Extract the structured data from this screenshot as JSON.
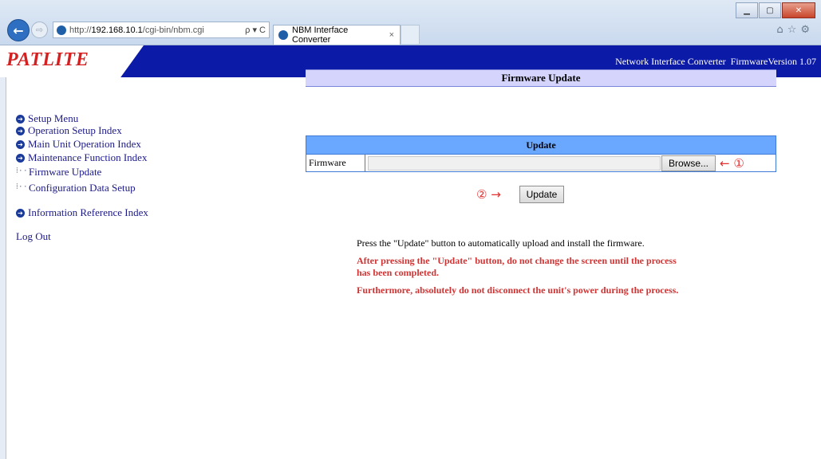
{
  "browser": {
    "url_prefix": "http://",
    "url_host": "192.168.10.1",
    "url_path": "/cgi-bin/nbm.cgi",
    "tab_title": "NBM Interface Converter",
    "tab_close": "×",
    "address_tools": "ρ ▾ C"
  },
  "header": {
    "logo": "PATLITE",
    "info": "Network Interface Converter  FirmwareVersion 1.07"
  },
  "sidebar": {
    "setup_menu": "Setup Menu",
    "operation_setup": "Operation Setup Index",
    "main_unit": "Main Unit Operation Index",
    "maintenance": "Maintenance Function Index",
    "firmware_update": "Firmware Update",
    "config_data": "Configuration Data Setup",
    "info_ref": "Information Reference Index",
    "logout": "Log Out"
  },
  "main": {
    "title": "Firmware Update",
    "table_header": "Update",
    "firmware_label": "Firmware",
    "browse_label": "Browse...",
    "marker1": "← ①",
    "marker2": "② →",
    "update_label": "Update",
    "instruction": "Press the \"Update\" button to automatically upload and install the firmware.",
    "warning1": "After pressing the \"Update\" button, do not change the screen until the process has been completed.",
    "warning2": "Furthermore, absolutely do not disconnect the unit's power during the process."
  },
  "colors": {
    "header_bg": "#0c1aa8",
    "logo_text": "#d42020",
    "title_bar": "#d4d4fd",
    "table_header": "#6aa7ff",
    "warning": "#cf3434"
  }
}
